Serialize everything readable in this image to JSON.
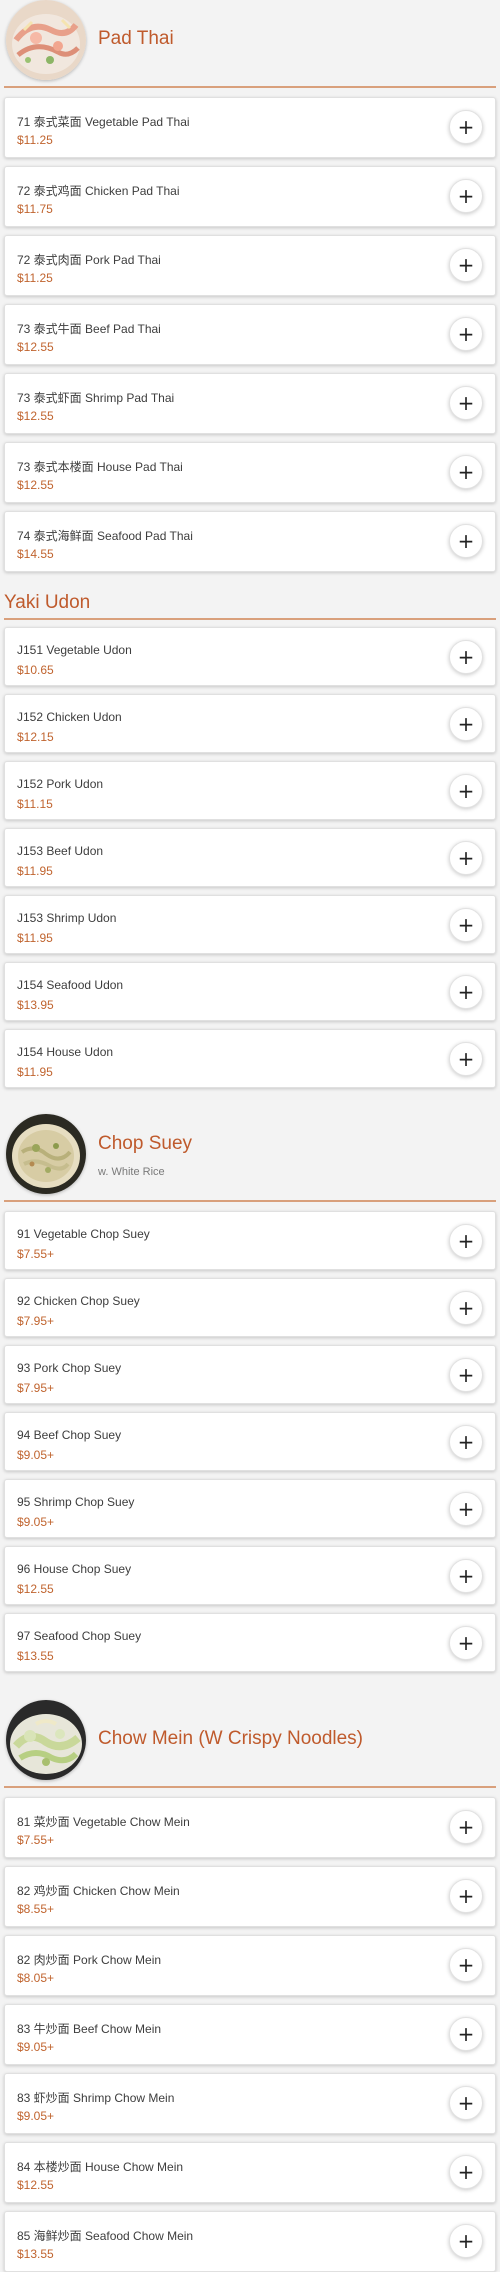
{
  "sections": [
    {
      "title": "Pad Thai",
      "subtitle": "",
      "items": [
        {
          "name": "71 泰式菜面 Vegetable Pad Thai",
          "price": "$11.25"
        },
        {
          "name": "72 泰式鸡面 Chicken Pad Thai",
          "price": "$11.75"
        },
        {
          "name": "72 泰式肉面 Pork Pad Thai",
          "price": "$11.25"
        },
        {
          "name": "73 泰式牛面 Beef Pad Thai",
          "price": "$12.55"
        },
        {
          "name": "73 泰式虾面 Shrimp Pad Thai",
          "price": "$12.55"
        },
        {
          "name": "73 泰式本楼面 House Pad Thai",
          "price": "$12.55"
        },
        {
          "name": "74 泰式海鲜面 Seafood Pad Thai",
          "price": "$14.55"
        }
      ]
    },
    {
      "title": "Yaki Udon",
      "subtitle": "",
      "items": [
        {
          "name": "J151 Vegetable Udon",
          "price": "$10.65"
        },
        {
          "name": "J152 Chicken Udon",
          "price": "$12.15"
        },
        {
          "name": "J152 Pork Udon",
          "price": "$11.15"
        },
        {
          "name": "J153 Beef Udon",
          "price": "$11.95"
        },
        {
          "name": "J153 Shrimp Udon",
          "price": "$11.95"
        },
        {
          "name": "J154 Seafood Udon",
          "price": "$13.95"
        },
        {
          "name": "J154 House Udon",
          "price": "$11.95"
        }
      ]
    },
    {
      "title": "Chop Suey",
      "subtitle": "w. White Rice",
      "items": [
        {
          "name": "91 Vegetable Chop Suey",
          "price": "$7.55+"
        },
        {
          "name": "92 Chicken Chop Suey",
          "price": "$7.95+"
        },
        {
          "name": "93 Pork Chop Suey",
          "price": "$7.95+"
        },
        {
          "name": "94 Beef Chop Suey",
          "price": "$9.05+"
        },
        {
          "name": "95 Shrimp Chop Suey",
          "price": "$9.05+"
        },
        {
          "name": "96 House Chop Suey",
          "price": "$12.55"
        },
        {
          "name": "97 Seafood Chop Suey",
          "price": "$13.55"
        }
      ]
    },
    {
      "title": "Chow Mein (W Crispy Noodles)",
      "subtitle": "",
      "items": [
        {
          "name": "81 菜炒面 Vegetable Chow Mein",
          "price": "$7.55+"
        },
        {
          "name": "82 鸡炒面 Chicken Chow Mein",
          "price": "$8.55+"
        },
        {
          "name": "82 肉炒面 Pork Chow Mein",
          "price": "$8.05+"
        },
        {
          "name": "83 牛炒面 Beef Chow Mein",
          "price": "$9.05+"
        },
        {
          "name": "83 虾炒面 Shrimp Chow Mein",
          "price": "$9.05+"
        },
        {
          "name": "84 本楼炒面 House Chow Mein",
          "price": "$12.55"
        },
        {
          "name": "85 海鲜炒面 Seafood Chow Mein",
          "price": "$13.55"
        }
      ]
    }
  ],
  "icons": {
    "add": "plus-icon"
  },
  "colors": {
    "accent": "#bf5a2c",
    "price": "#c0642f",
    "divider": "#d9a07c"
  }
}
